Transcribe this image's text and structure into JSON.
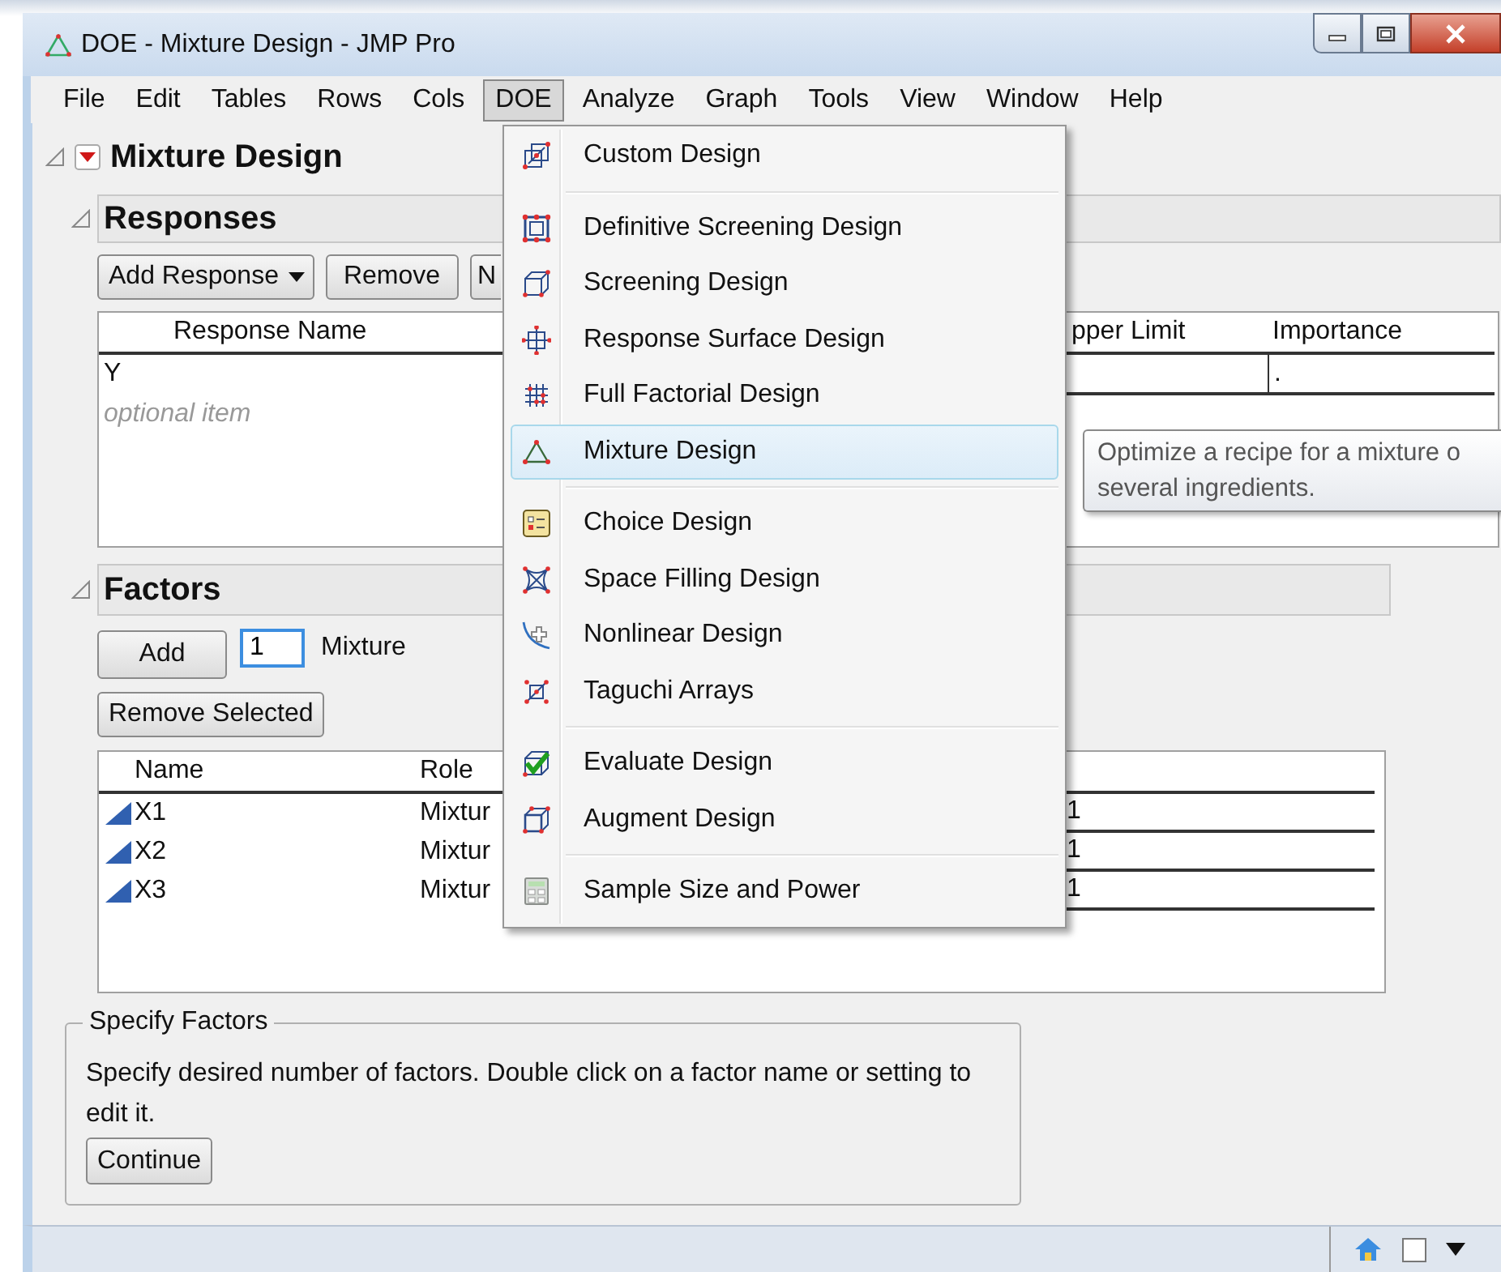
{
  "window": {
    "title": "DOE - Mixture Design - JMP Pro"
  },
  "menu_bar": [
    {
      "label": "File",
      "selected": false
    },
    {
      "label": "Edit",
      "selected": false
    },
    {
      "label": "Tables",
      "selected": false
    },
    {
      "label": "Rows",
      "selected": false
    },
    {
      "label": "Cols",
      "selected": false
    },
    {
      "label": "DOE",
      "selected": true
    },
    {
      "label": "Analyze",
      "selected": false
    },
    {
      "label": "Graph",
      "selected": false
    },
    {
      "label": "Tools",
      "selected": false
    },
    {
      "label": "View",
      "selected": false
    },
    {
      "label": "Window",
      "selected": false
    },
    {
      "label": "Help",
      "selected": false
    }
  ],
  "outline": {
    "title": "Mixture Design",
    "expanded": true
  },
  "responses": {
    "title": "Responses",
    "expanded": true,
    "buttons": [
      {
        "label": "Add Response",
        "kind": "dropdown"
      },
      {
        "label": "Remove",
        "kind": "plain"
      },
      {
        "label": "N",
        "kind": "plain"
      }
    ],
    "columns": [
      "Response Name",
      "pper Limit",
      "Importance"
    ],
    "rows": [
      {
        "name": "Y",
        "importance": "."
      }
    ],
    "placeholder": "optional item"
  },
  "factors": {
    "title": "Factors",
    "expanded": true,
    "add_button": "Add",
    "count_field": {
      "value": "1"
    },
    "type_label": "Mixture",
    "remove_button": "Remove Selected",
    "columns": [
      "Name",
      "Role"
    ],
    "rows": [
      {
        "name": "X1",
        "role": "Mixtur",
        "column_3": "1"
      },
      {
        "name": "X2",
        "role": "Mixtur",
        "column_3": "1"
      },
      {
        "name": "X3",
        "role": "Mixtur",
        "column_3": "1"
      }
    ]
  },
  "specify_factors": {
    "title": "Specify Factors",
    "text": "Specify desired number of factors. Double click on a factor name or setting to edit it.",
    "button": "Continue"
  },
  "doe_menu": {
    "groups": [
      [
        {
          "label": "Custom Design",
          "kind": "custom",
          "selected": false
        }
      ],
      [
        {
          "label": "Definitive Screening Design",
          "kind": "definitive",
          "selected": false
        },
        {
          "label": "Screening Design",
          "kind": "screening",
          "selected": false
        },
        {
          "label": "Response Surface Design",
          "kind": "surface",
          "selected": false
        },
        {
          "label": "Full Factorial Design",
          "kind": "factorial",
          "selected": false
        },
        {
          "label": "Mixture Design",
          "kind": "mixture",
          "selected": true
        }
      ],
      [
        {
          "label": "Choice Design",
          "kind": "choice",
          "selected": false
        },
        {
          "label": "Space Filling Design",
          "kind": "filling",
          "selected": false
        },
        {
          "label": "Nonlinear Design",
          "kind": "nonlinear",
          "selected": false
        },
        {
          "label": "Taguchi Arrays",
          "kind": "taguchi",
          "selected": false
        }
      ],
      [
        {
          "label": "Evaluate Design",
          "kind": "evaluate",
          "selected": false
        },
        {
          "label": "Augment Design",
          "kind": "augment",
          "selected": false
        }
      ],
      [
        {
          "label": "Sample Size and Power",
          "kind": "calculator",
          "selected": false
        }
      ]
    ]
  },
  "tooltip": {
    "lines": [
      "Optimize a recipe for a mixture o",
      "several ingredients."
    ]
  },
  "status_bar": {
    "checkbox": {
      "checked": false
    }
  }
}
